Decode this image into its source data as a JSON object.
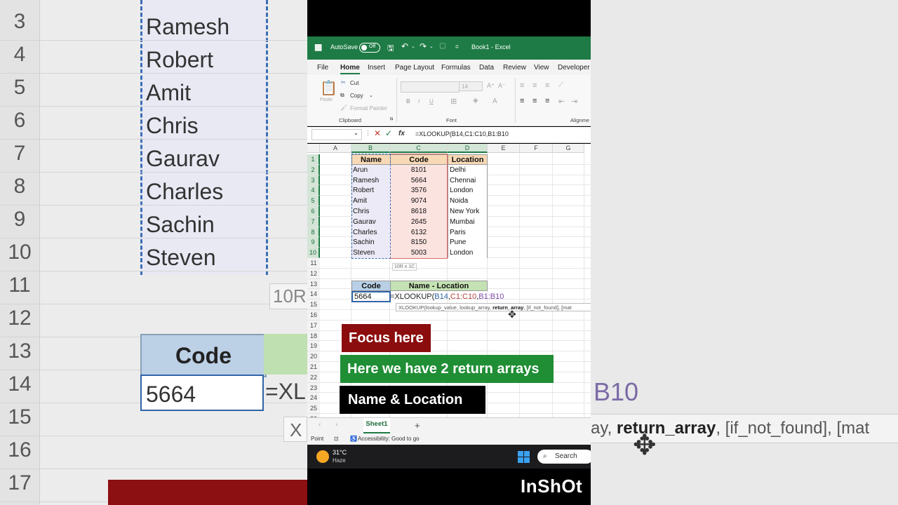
{
  "titlebar": {
    "autosave": "AutoSave",
    "toggle_off": "Off",
    "book": "Book1",
    "sep": "-",
    "app": "Excel"
  },
  "menu": [
    "File",
    "Home",
    "Insert",
    "Page Layout",
    "Formulas",
    "Data",
    "Review",
    "View",
    "Developer"
  ],
  "ribbon": {
    "paste": "Paste",
    "cut": "Cut",
    "copy": "Copy",
    "format_painter": "Format Painter",
    "clipboard": "Clipboard",
    "font": "Font",
    "alignment": "Alignme",
    "font_size": "14"
  },
  "formula_bar": {
    "fx": "fx",
    "text": "=XLOOKUP(B14,C1:C10,B1:B10"
  },
  "columns": [
    "A",
    "B",
    "C",
    "D",
    "E",
    "F",
    "G"
  ],
  "rows": [
    "1",
    "2",
    "3",
    "4",
    "5",
    "6",
    "7",
    "8",
    "9",
    "10",
    "11",
    "12",
    "13",
    "14",
    "15",
    "16",
    "17",
    "18",
    "19",
    "20",
    "21",
    "22",
    "23",
    "24",
    "25",
    "26"
  ],
  "table": {
    "headers": [
      "Name",
      "Code",
      "Location"
    ],
    "rows": [
      [
        "Arun",
        "8101",
        "Delhi"
      ],
      [
        "Ramesh",
        "5664",
        "Chennai"
      ],
      [
        "Robert",
        "3576",
        "London"
      ],
      [
        "Amit",
        "9074",
        "Noida"
      ],
      [
        "Chris",
        "8618",
        "New York"
      ],
      [
        "Gaurav",
        "2645",
        "Mumbai"
      ],
      [
        "Charles",
        "6132",
        "Paris"
      ],
      [
        "Sachin",
        "8150",
        "Pune"
      ],
      [
        "Steven",
        "5003",
        "London"
      ]
    ]
  },
  "selection_tip": "10R x 1C",
  "lookup": {
    "code_header": "Code",
    "result_header": "Name - Location",
    "code_value": "5664",
    "formula_prefix": "=XLOOKUP(",
    "arg1": "B14",
    "comma1": ",",
    "arg2": "C1:C10",
    "comma2": ",",
    "arg3": "B1:B10"
  },
  "arg_tooltip": {
    "prefix": "XLOOKUP(lookup_value, lookup_array, ",
    "current": "return_array",
    "suffix": ", [if_not_found], [mat"
  },
  "callouts": {
    "red": "Focus here",
    "green": "Here we have 2 return arrays",
    "black": "Name & Location"
  },
  "sheet": {
    "tab": "Sheet1",
    "add": "+"
  },
  "status": {
    "mode": "Point",
    "accessibility": "Accessibility: Good to go"
  },
  "taskbar": {
    "temp": "31°C",
    "weather": "Haze",
    "search": "Search"
  },
  "watermark": "InShOt",
  "background": {
    "rownums": [
      "3",
      "4",
      "5",
      "6",
      "7",
      "8",
      "9",
      "10",
      "11",
      "12",
      "13",
      "14",
      "15",
      "16",
      "17"
    ],
    "names": [
      "Ramesh",
      "Robert",
      "Amit",
      "Chris",
      "Gaurav",
      "Charles",
      "Sachin",
      "Steven"
    ],
    "code_header": "Code",
    "code_value": "5664",
    "formula_fragment": "=XL",
    "tip": "10R",
    "tip_x": "X",
    "b10": "B10",
    "tip_prefix": "ay, ",
    "tip_bold": "return_array",
    "tip_suffix": ", [if_not_found], [mat"
  },
  "colors": {
    "excel_green": "#1e7b45",
    "callout_red": "#8b0d0e",
    "callout_green": "#1f8e35",
    "name_header": "#f8d9b5",
    "code_cell": "#fbe3e0",
    "lookup_code_header": "#b8cfe6",
    "lookup_result_header": "#c4e2b3"
  }
}
